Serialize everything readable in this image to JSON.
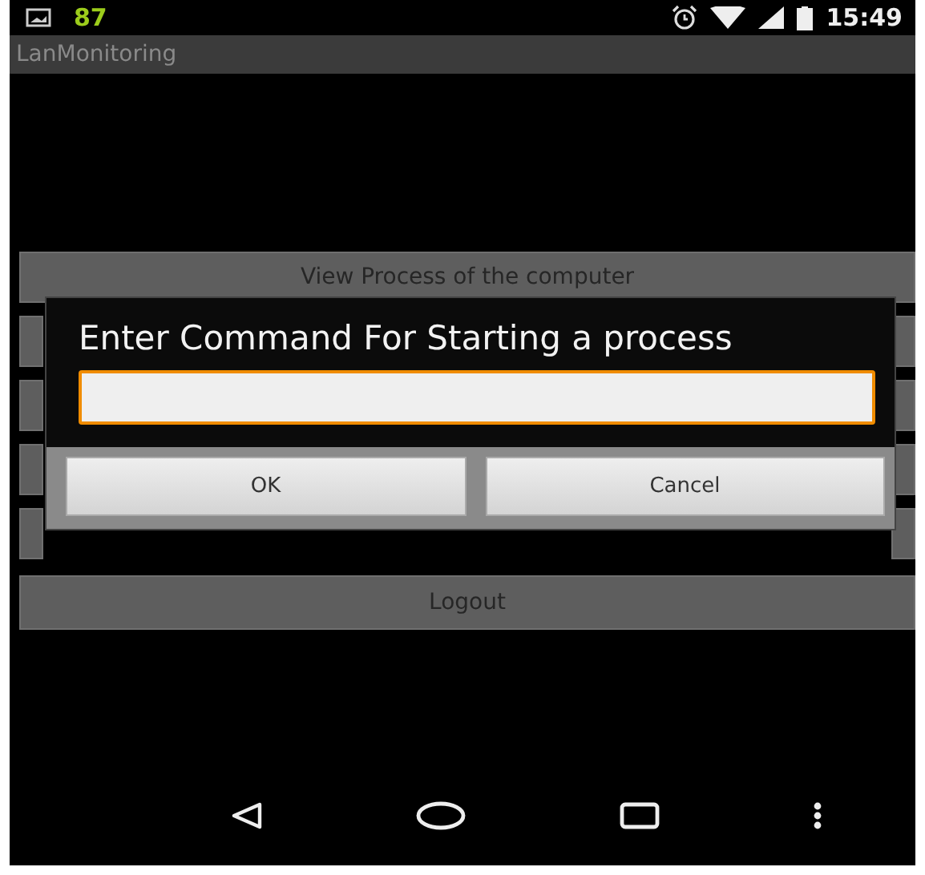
{
  "status_bar": {
    "notification_count": "87",
    "time": "15:49"
  },
  "app_bar": {
    "title": "LanMonitoring"
  },
  "menu_buttons": [
    {
      "kind": "labeled",
      "label": "View Process of the computer"
    },
    {
      "kind": "covered"
    },
    {
      "kind": "covered"
    },
    {
      "kind": "covered"
    },
    {
      "kind": "covered"
    },
    {
      "kind": "labeled",
      "label": "Logout"
    }
  ],
  "dialog": {
    "title": "Enter Command For Starting a process",
    "input": {
      "focused": true
    },
    "buttons": [
      "OK",
      "Cancel"
    ]
  }
}
